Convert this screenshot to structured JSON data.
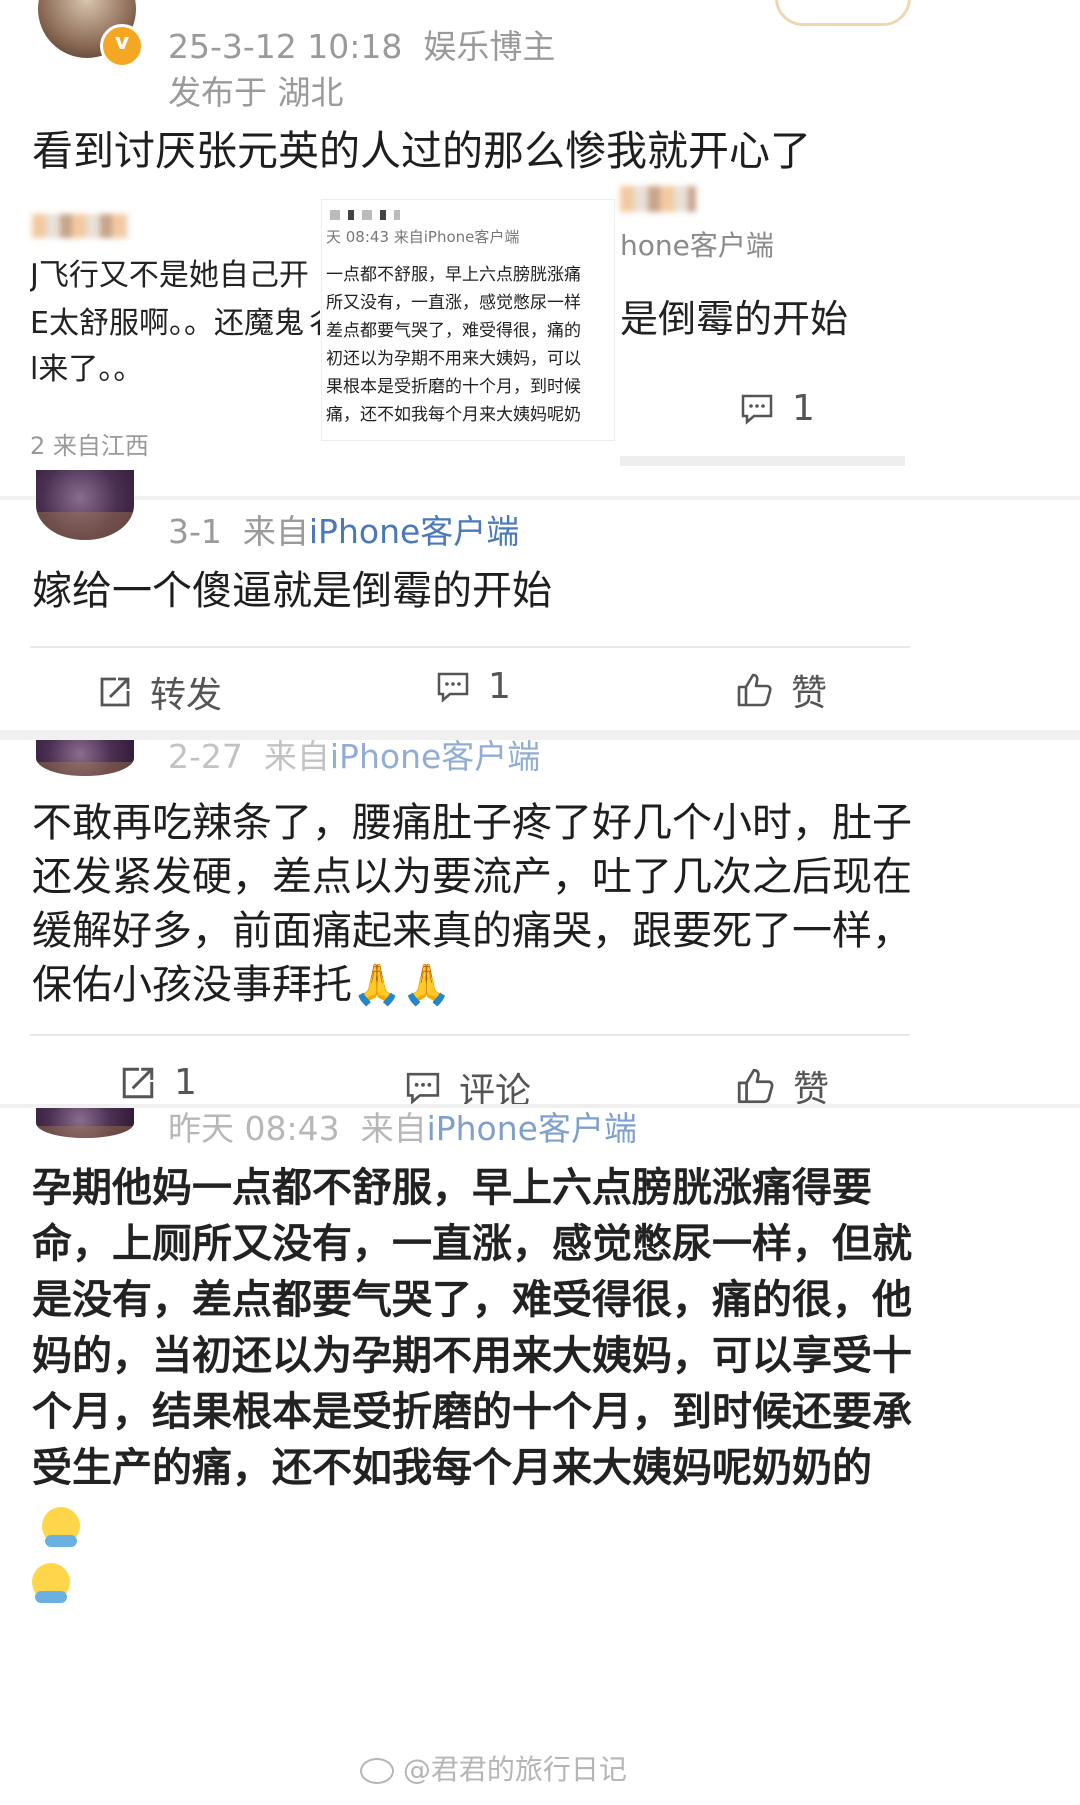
{
  "post1": {
    "date": "25-3-12 10:18",
    "role": "娱乐博主",
    "location": "发布于 湖北",
    "text": "看到讨厌张元英的人过的那么惨我就开心了",
    "verified_badge": "v"
  },
  "embedded": {
    "left_lines": [
      "J飞行又不是她自己开",
      "E太舒服啊。。还魔鬼彳",
      "l来了。。"
    ],
    "left_meta": "2 来自江西",
    "center_time": "天 08:43 来自iPhone客户端",
    "center_lines": [
      "一点都不舒服，早上六点膀胱涨痛",
      "所又没有，一直涨，感觉憋尿一样",
      "差点都要气哭了，难受得很，痛的",
      "初还以为孕期不用来大姨妈，可以",
      "果根本是受折磨的十个月，到时候",
      "痛，还不如我每个月来大姨妈呢奶"
    ],
    "right_source": "hone客户端",
    "right_text": "是倒霉的开始",
    "right_comment_count": "1"
  },
  "post2": {
    "meta_date": "3-1",
    "meta_from": "来自",
    "meta_client": "iPhone客户端",
    "text": "嫁给一个傻逼就是倒霉的开始",
    "repost_label": "转发",
    "comment_count": "1",
    "like_label": "赞"
  },
  "post3": {
    "meta_date": "2-27",
    "meta_from": "来自",
    "meta_client": "iPhone客户端",
    "text": "不敢再吃辣条了，腰痛肚子疼了好几个小时，肚子还发紧发硬，差点以为要流产，吐了几次之后现在缓解好多，前面痛起来真的痛哭，跟要死了一样，保佑小孩没事拜托🙏🙏",
    "repost_count": "1",
    "comment_label": "评论",
    "like_label": "赞"
  },
  "post4": {
    "meta_date": "昨天 08:43",
    "meta_from": "来自",
    "meta_client": "iPhone客户端",
    "text": "孕期他妈一点都不舒服，早上六点膀胱涨痛得要命，上厕所又没有，一直涨，感觉憋尿一样，但就是没有，差点都要气哭了，难受得很，痛的很，他妈的，当初还以为孕期不用来大姨妈，可以享受十个月，结果根本是受折磨的十个月，到时候还要承受生产的痛，还不如我每个月来大姨妈呢奶奶的"
  },
  "watermark": "@君君的旅行日记",
  "icons": [
    "repost-icon",
    "comment-icon",
    "like-icon",
    "weibo-logo-icon",
    "pray-emoji",
    "face-emoji"
  ]
}
